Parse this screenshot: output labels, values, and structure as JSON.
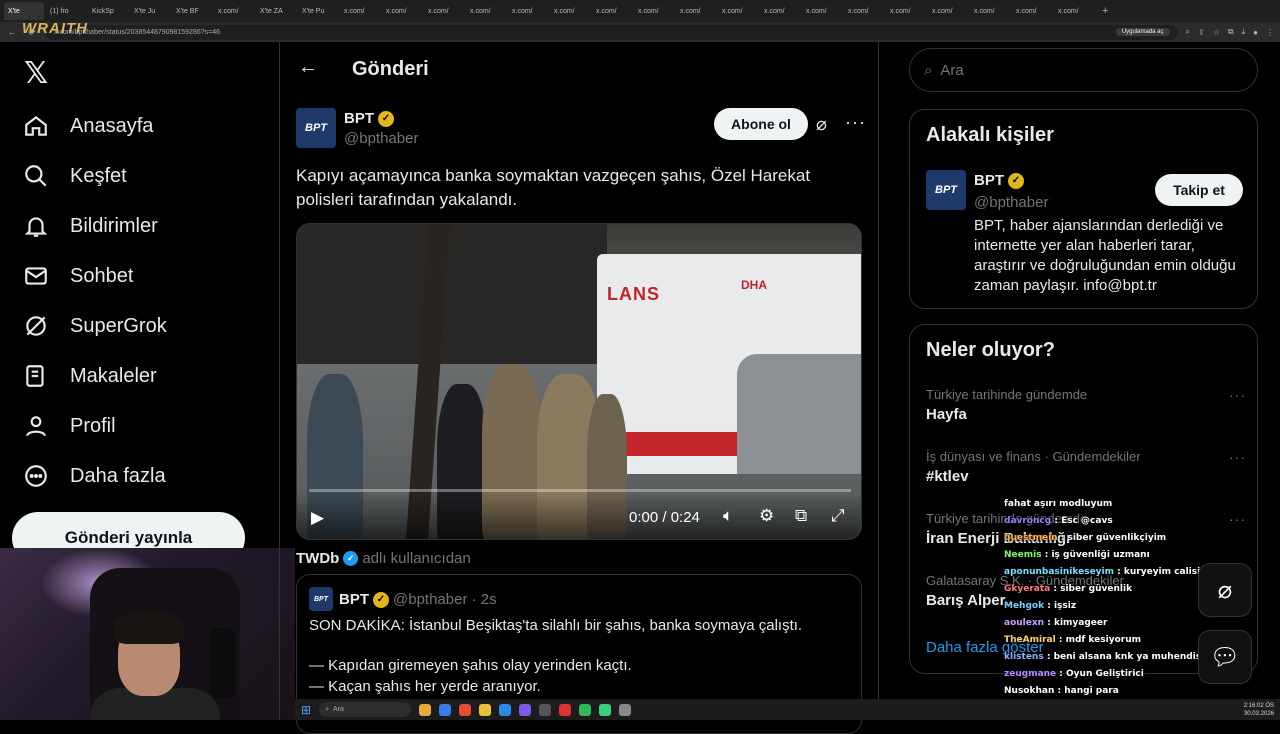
{
  "browser": {
    "tabs": [
      "X'te",
      "(1) fro",
      "KickSp",
      "X'te Ju",
      "X'te BF",
      "x.com/",
      "X'te ZA",
      "X'te Pu",
      "x.com/",
      "x.com/",
      "x.com/",
      "x.com/",
      "x.com/",
      "x.com/",
      "x.com/",
      "x.com/",
      "x.com/",
      "x.com/",
      "x.com/",
      "x.com/",
      "x.com/",
      "x.com/",
      "x.com/",
      "x.com/",
      "x.com/",
      "x.com/"
    ],
    "url": "x.com/bptthaber/status/2038544879098159286?s=46",
    "open_in_app": "Uygulamada aç",
    "overlay_brand": "WRAITH"
  },
  "nav": {
    "items": [
      {
        "label": "Anasayfa",
        "icon": "home-icon"
      },
      {
        "label": "Keşfet",
        "icon": "search-icon"
      },
      {
        "label": "Bildirimler",
        "icon": "bell-icon"
      },
      {
        "label": "Sohbet",
        "icon": "mail-icon"
      },
      {
        "label": "SuperGrok",
        "icon": "grok-icon"
      },
      {
        "label": "Makaleler",
        "icon": "article-icon"
      },
      {
        "label": "Profil",
        "icon": "user-icon"
      },
      {
        "label": "Daha fazla",
        "icon": "more-circle-icon"
      }
    ],
    "post_button": "Gönderi yayınla"
  },
  "main": {
    "title": "Gönderi",
    "tweet": {
      "avatar_text": "BPT",
      "name": "BPT",
      "handle": "@bpthaber",
      "follow_label": "Abone ol",
      "text": "Kapıyı açamayınca banka soymaktan vazgeçen şahıs, Özel Harekat polisleri tarafından yakalandı.",
      "video": {
        "ambulance_text": "LANS",
        "watermark": "DHA",
        "time": "0:00 / 0:24",
        "progress": 0
      }
    },
    "repost": {
      "name": "TWDb",
      "suffix": "adlı kullanıcıdan"
    },
    "quote": {
      "avatar_text": "BPT",
      "name": "BPT",
      "handle": "@bpthaber · 2s",
      "lines": [
        "SON DAKİKA: İstanbul Beşiktaş'ta silahlı bir şahıs, banka soymaya çalıştı.",
        "— Kapıdan giremeyen şahıs olay yerinden kaçtı.",
        "— Kaçan şahıs her yerde aranıyor."
      ]
    }
  },
  "right": {
    "search_placeholder": "Ara",
    "related": {
      "title": "Alakalı kişiler",
      "avatar_text": "BPT",
      "name": "BPT",
      "handle": "@bpthaber",
      "follow_label": "Takip et",
      "bio": "BPT, haber ajanslarından derlediği ve internette yer alan haberleri tarar, araştırır ve doğruluğundan emin olduğu zaman paylaşır. info@bpt.tr"
    },
    "trends": {
      "title": "Neler oluyor?",
      "items": [
        {
          "meta": "Türkiye tarihinde gündemde",
          "name": "Hayfa"
        },
        {
          "meta": "İş dünyası ve finans · Gündemdekiler",
          "name": "#ktlev"
        },
        {
          "meta": "Türkiye tarihinde gündemde",
          "name": "İran Enerji Bakanlığı"
        },
        {
          "meta": "Galatasaray S.K. · Gündemdekiler",
          "name": "Barış Alper"
        }
      ],
      "show_more": "Daha fazla göster"
    }
  },
  "chat": [
    {
      "user": "",
      "color": "#cccccc",
      "msg": "fahat aşırı modluyum"
    },
    {
      "user": "davroncg",
      "color": "#9b7bff",
      "msg": "Esc @cavs"
    },
    {
      "user": "",
      "color": "#ffffff",
      "msg": ""
    },
    {
      "user": "questmein",
      "color": "#ffb23f",
      "msg": "siber güvenlikçiyim"
    },
    {
      "user": "Neemis",
      "color": "#7cff6b",
      "msg": "iş güvenliği uzmanı"
    },
    {
      "user": "aponunbasinikeseyim",
      "color": "#6fe3ff",
      "msg": "kuryeyim calisirken dinliyom"
    },
    {
      "user": "Gkyerata",
      "color": "#ff7b7b",
      "msg": "siber güvenlik"
    },
    {
      "user": "Mehgok",
      "color": "#78d0ff",
      "msg": "işsiz"
    },
    {
      "user": "aoulexn",
      "color": "#c6a0ff",
      "msg": "kimyageer"
    },
    {
      "user": "TheAmiral",
      "color": "#ffd86b",
      "msg": "mdf kesiyorum"
    },
    {
      "user": "klistens",
      "color": "#8fb0ff",
      "msg": "beni alsana knk ya muhendisim"
    },
    {
      "user": "zeugmane",
      "color": "#b58cff",
      "msg": "Oyun Geliştirici"
    },
    {
      "user": "Nusokhan",
      "color": "#ffffff",
      "msg": "hangi para"
    }
  ],
  "taskbar": {
    "search": "Ara",
    "time": "2:16:02 ÖS",
    "date": "30.03.2026"
  }
}
